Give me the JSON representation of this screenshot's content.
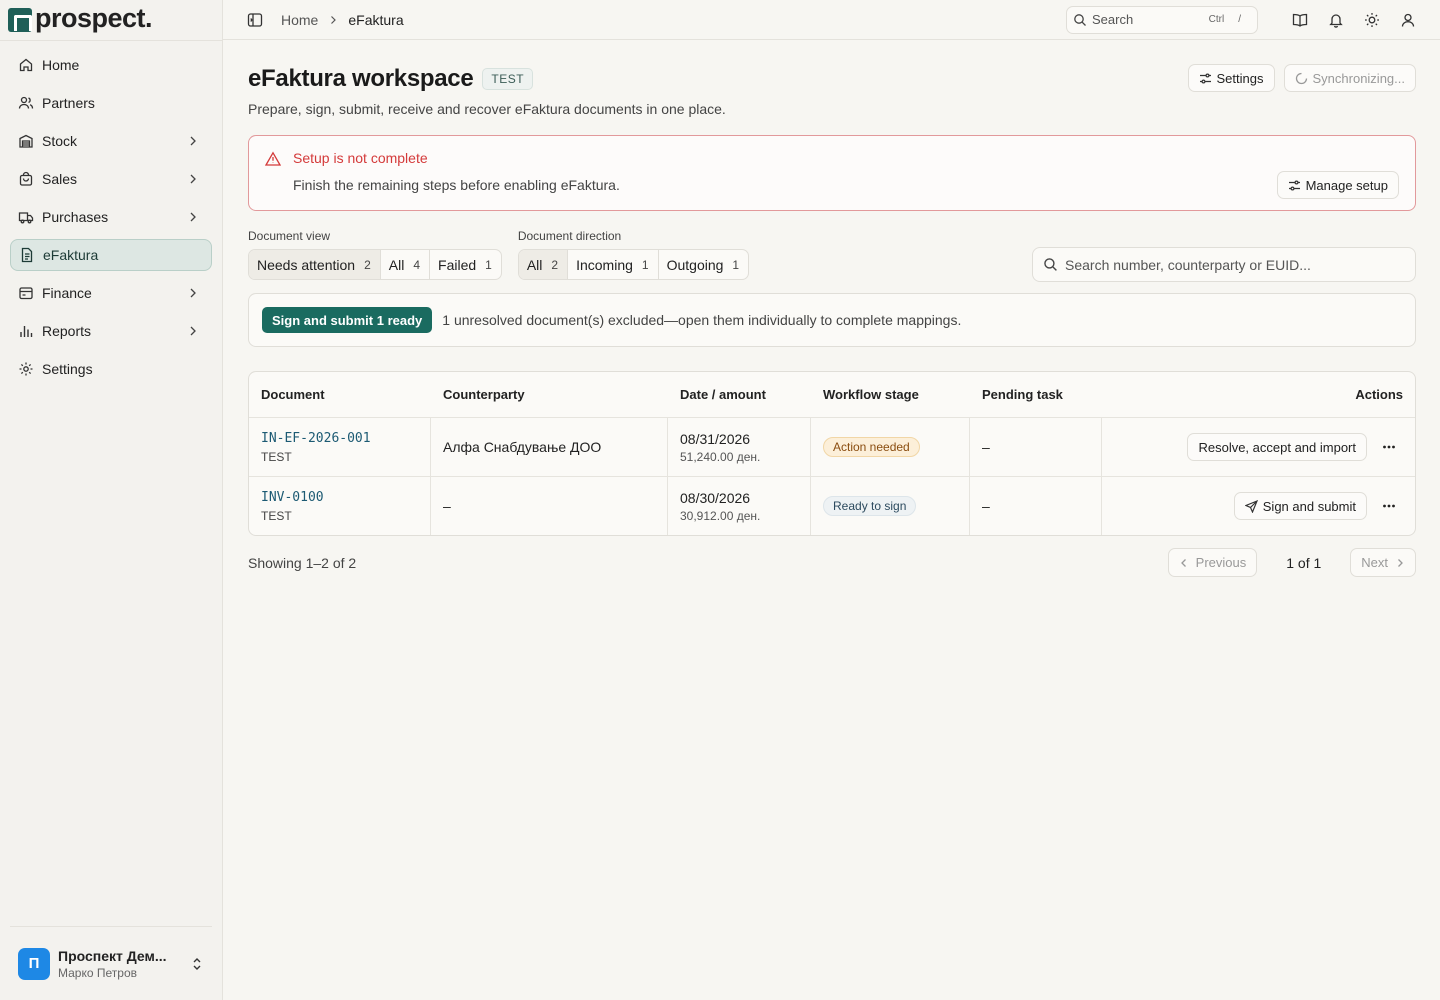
{
  "brand": {
    "name": "prospect."
  },
  "sidebar": {
    "items": [
      {
        "label": "Home",
        "icon": "home-icon"
      },
      {
        "label": "Partners",
        "icon": "users-icon"
      },
      {
        "label": "Stock",
        "icon": "warehouse-icon"
      },
      {
        "label": "Sales",
        "icon": "bag-icon"
      },
      {
        "label": "Purchases",
        "icon": "truck-icon"
      },
      {
        "label": "eFaktura",
        "icon": "document-icon"
      },
      {
        "label": "Finance",
        "icon": "wallet-icon"
      },
      {
        "label": "Reports",
        "icon": "bar-chart-icon"
      },
      {
        "label": "Settings",
        "icon": "gear-icon"
      }
    ],
    "active": "eFaktura",
    "footer": {
      "avatar_letter": "П",
      "org_name": "Проспект Дем...",
      "user_name": "Марко Петров"
    }
  },
  "topbar": {
    "breadcrumb": {
      "home": "Home",
      "current": "eFaktura"
    },
    "search": {
      "placeholder": "Search",
      "kbd1": "Ctrl",
      "kbd2": "/"
    }
  },
  "page": {
    "title": "eFaktura workspace",
    "env_badge": "TEST",
    "subtitle": "Prepare, sign, submit, receive and recover eFaktura documents in one place.",
    "settings_label": "Settings",
    "sync_label": "Synchronizing..."
  },
  "alert": {
    "title": "Setup is not complete",
    "text": "Finish the remaining steps before enabling eFaktura.",
    "button": "Manage setup"
  },
  "filters": {
    "view_label": "Document view",
    "view": [
      {
        "label": "Needs attention",
        "count": "2"
      },
      {
        "label": "All",
        "count": "4"
      },
      {
        "label": "Failed",
        "count": "1"
      }
    ],
    "direction_label": "Document direction",
    "direction": [
      {
        "label": "All",
        "count": "2"
      },
      {
        "label": "Incoming",
        "count": "1"
      },
      {
        "label": "Outgoing",
        "count": "1"
      }
    ],
    "search_placeholder": "Search number, counterparty or EUID..."
  },
  "bulk": {
    "button": "Sign and submit 1 ready",
    "text": "1 unresolved document(s) excluded—open them individually to complete mappings."
  },
  "table": {
    "headers": [
      "Document",
      "Counterparty",
      "Date / amount",
      "Workflow stage",
      "Pending task",
      "Actions"
    ],
    "rows": [
      {
        "number": "IN-EF-2026-001",
        "tag": "TEST",
        "counterparty": "Алфа Снабдување ДОО",
        "date": "08/31/2026",
        "amount": "51,240.00 ден.",
        "stage": "Action needed",
        "pending": "–",
        "action": "Resolve, accept and import"
      },
      {
        "number": "INV-0100",
        "tag": "TEST",
        "counterparty": "–",
        "date": "08/30/2026",
        "amount": "30,912.00 ден.",
        "stage": "Ready to sign",
        "pending": "–",
        "action": "Sign and submit"
      }
    ]
  },
  "pager": {
    "showing": "Showing 1–2 of 2",
    "previous": "Previous",
    "page_info": "1 of 1",
    "next": "Next"
  },
  "colors": {
    "accent": "#1a6b60",
    "danger": "#d43a3a",
    "background": "#f7f6f2"
  }
}
